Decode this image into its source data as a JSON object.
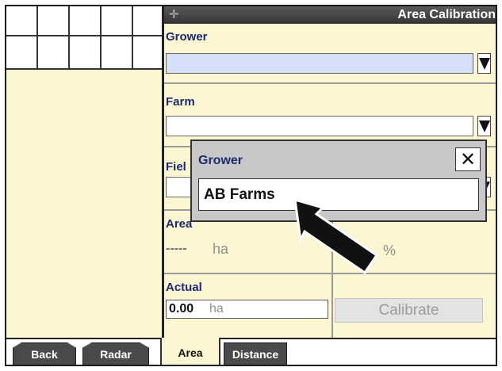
{
  "header": {
    "title": "Area Calibration"
  },
  "grower": {
    "label": "Grower"
  },
  "farm": {
    "label": "Farm"
  },
  "field": {
    "label": "Fiel"
  },
  "area": {
    "label": "Area",
    "value": "-----",
    "unit": "ha",
    "pct_value": "----",
    "pct_unit": "%"
  },
  "actual": {
    "label": "Actual",
    "value": "0.00",
    "unit": "ha",
    "calibrate_label": "Calibrate"
  },
  "tabs": [
    {
      "label": "Back"
    },
    {
      "label": "Radar"
    },
    {
      "label": "Area"
    },
    {
      "label": "Distance"
    }
  ],
  "popup": {
    "title": "Grower",
    "value": "AB Farms",
    "close_symbol": "✕"
  },
  "icons": {
    "header": "crosshair-icon",
    "dropdown": "dropdown-arrow-icon",
    "close": "close-icon",
    "pointer": "arrow-pointer-icon"
  },
  "colors": {
    "background": "#fdf6d2",
    "header": "#3c3c3c",
    "label": "#1c2a70",
    "selected_field": "#d6e0f8",
    "popup": "#c8c8c8"
  }
}
